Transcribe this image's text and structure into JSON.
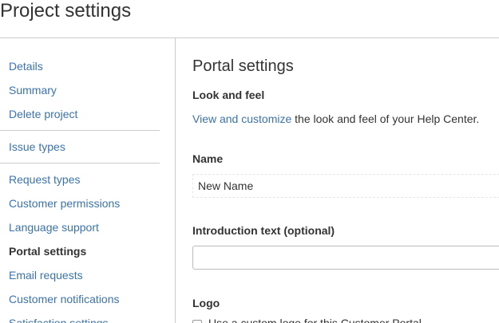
{
  "header": {
    "title": "Project settings"
  },
  "sidebar": {
    "items": [
      {
        "label": "Details"
      },
      {
        "label": "Summary"
      },
      {
        "label": "Delete project"
      },
      {
        "label": "Issue types"
      },
      {
        "label": "Request types"
      },
      {
        "label": "Customer permissions"
      },
      {
        "label": "Language support"
      },
      {
        "label": "Portal settings",
        "active": true
      },
      {
        "label": "Email requests"
      },
      {
        "label": "Customer notifications"
      },
      {
        "label": "Satisfaction settings"
      }
    ]
  },
  "main": {
    "section_title": "Portal settings",
    "look_and_feel": {
      "heading": "Look and feel",
      "link": "View and customize",
      "text": " the look and feel of your Help Center."
    },
    "name": {
      "label": "Name",
      "value": "New Name"
    },
    "intro": {
      "label": "Introduction text (optional)",
      "value": ""
    },
    "logo": {
      "label": "Logo",
      "option": "Use a custom logo for this Customer Portal"
    }
  }
}
